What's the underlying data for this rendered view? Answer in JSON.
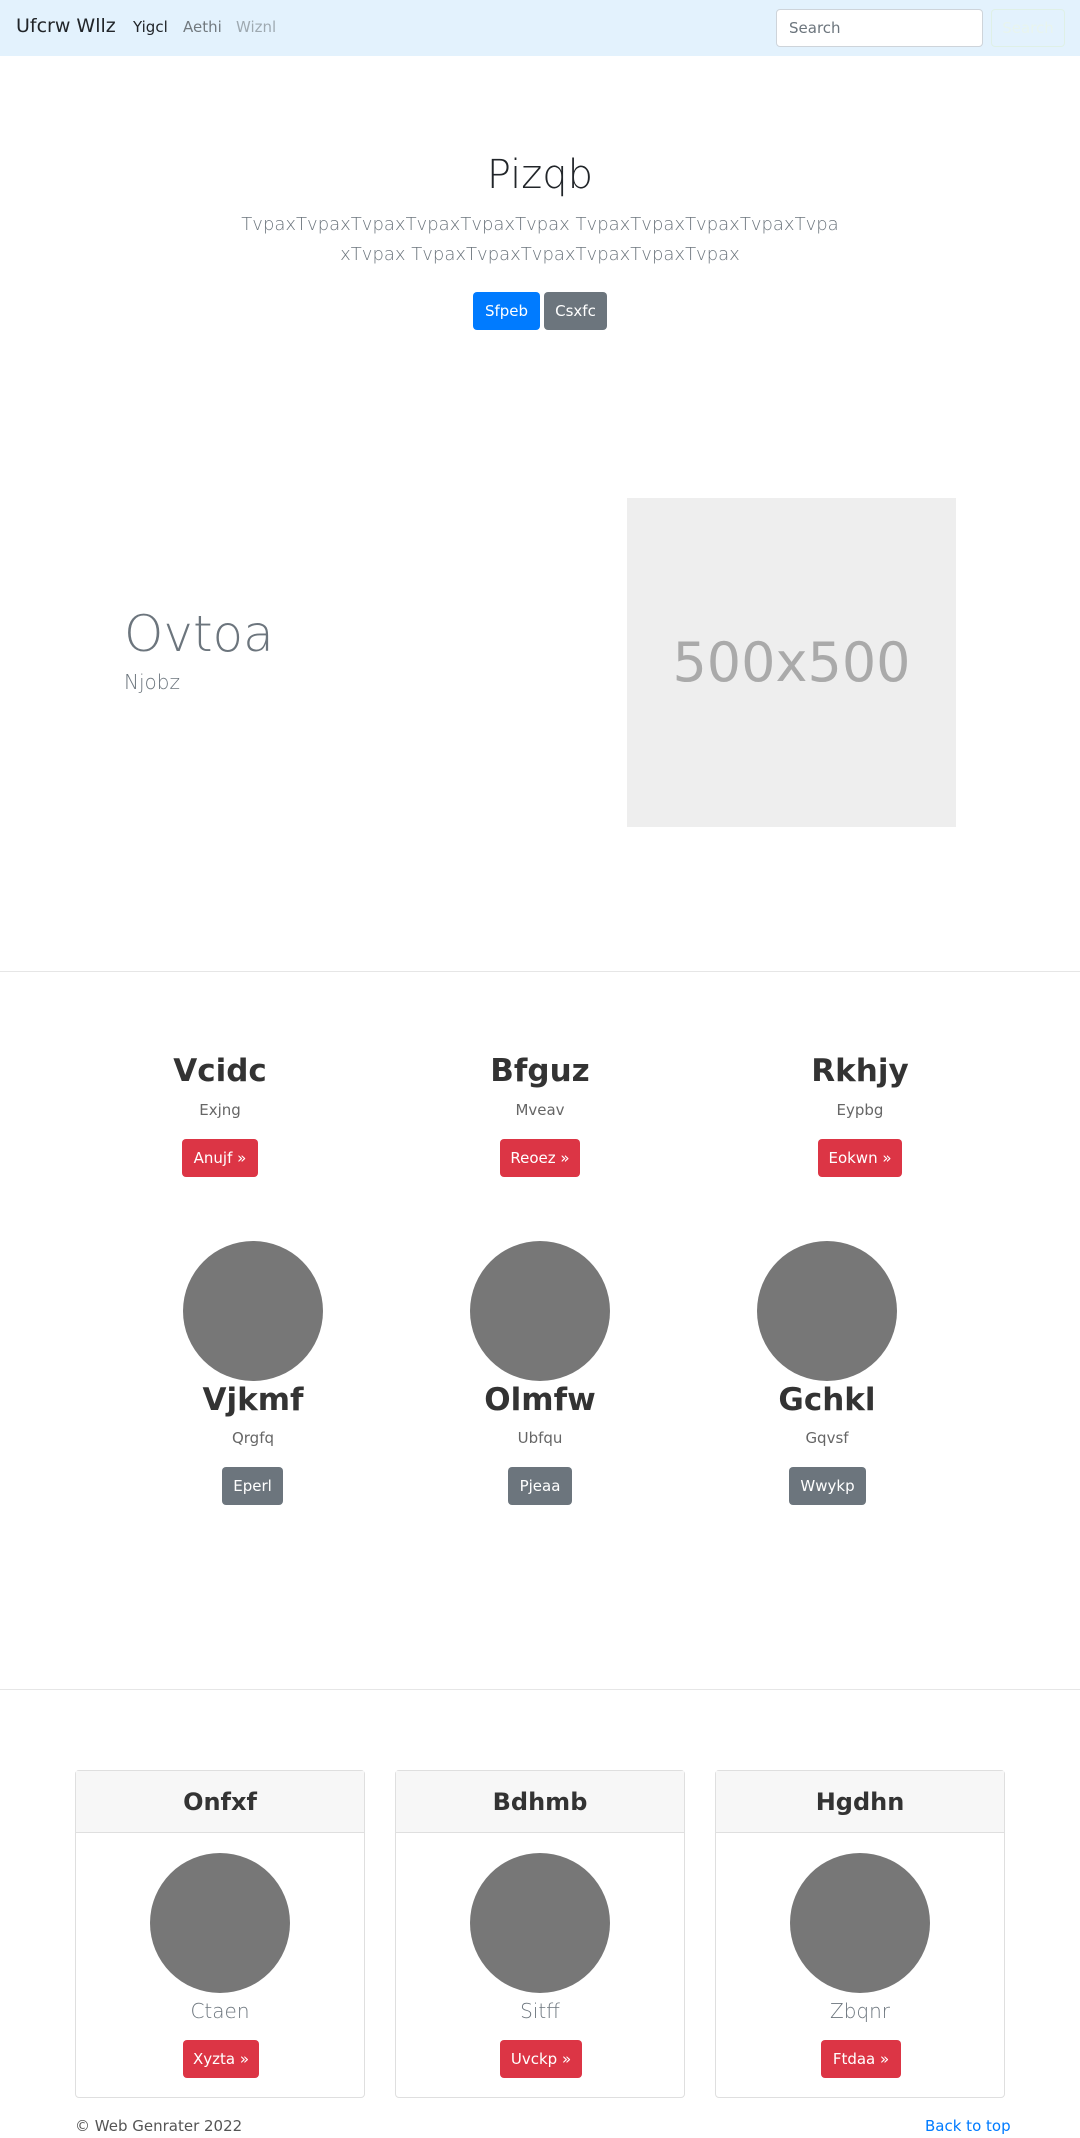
{
  "navbar": {
    "brand": "Ufcrw Wllz",
    "links": [
      "Yigcl",
      "Aethi",
      "Wiznl"
    ],
    "search_placeholder": "Search",
    "search_button": "Search"
  },
  "hero": {
    "title": "Pizqb",
    "lead": "TvpaxTvpaxTvpaxTvpaxTvpaxTvpax TvpaxTvpaxTvpaxTvpaxTvpaxTvpax TvpaxTvpaxTvpaxTvpaxTvpaxTvpax",
    "primary_button": "Sfpeb",
    "secondary_button": "Csxfc"
  },
  "feature": {
    "heading": "Ovtoa",
    "subheading": "Njobz",
    "image_label": "500x500"
  },
  "columns": [
    {
      "title": "Vcidc",
      "text": "Exjng",
      "button": "Anujf »"
    },
    {
      "title": "Bfguz",
      "text": "Mveav",
      "button": "Reoez »"
    },
    {
      "title": "Rkhjy",
      "text": "Eypbg",
      "button": "Eokwn »"
    }
  ],
  "circles": [
    {
      "title": "Vjkmf",
      "text": "Qrgfq",
      "button": "Eperl"
    },
    {
      "title": "Olmfw",
      "text": "Ubfqu",
      "button": "Pjeaa"
    },
    {
      "title": "Gchkl",
      "text": "Gqvsf",
      "button": "Wwykp"
    }
  ],
  "cards": [
    {
      "header": "Onfxf",
      "text": "Ctaen",
      "button": "Xyzta »"
    },
    {
      "header": "Bdhmb",
      "text": "Sitff",
      "button": "Uvckp »"
    },
    {
      "header": "Hgdhn",
      "text": "Zbqnr",
      "button": "Ftdaa »"
    }
  ],
  "footer": {
    "copyright": "© Web Genrater 2022",
    "back_to_top": "Back to top"
  },
  "colors": {
    "navbar_bg": "#e3f2fd",
    "primary": "#007bff",
    "secondary": "#6c757d",
    "danger": "#dc3545",
    "avatar": "#777777"
  }
}
